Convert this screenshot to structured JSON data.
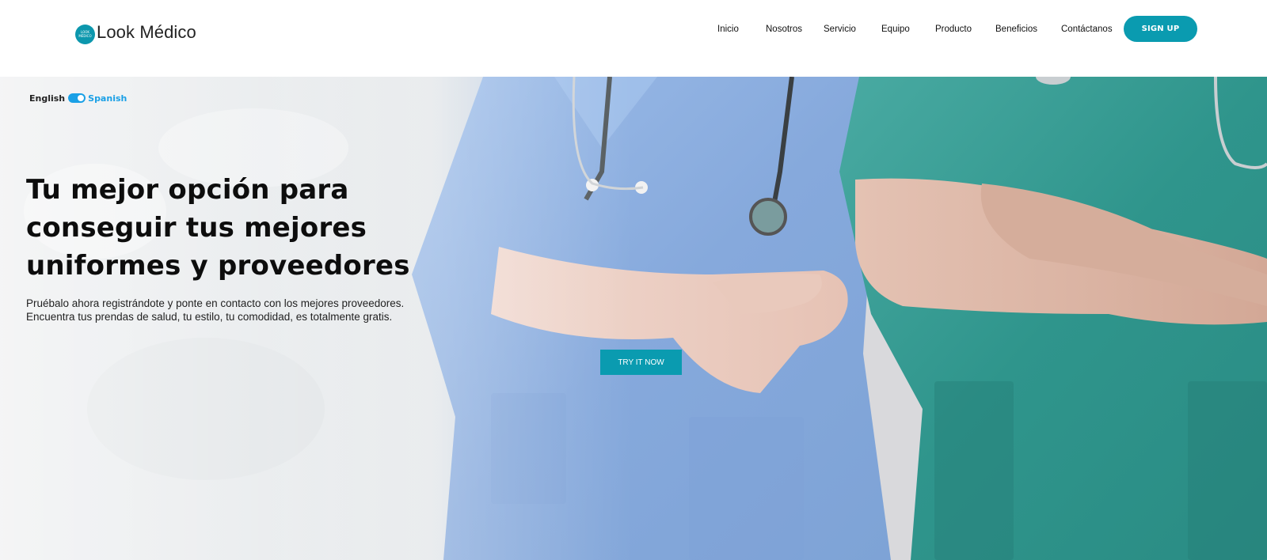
{
  "header": {
    "brand": {
      "logo_text_top": "LOOK",
      "logo_text_bottom": "MÉDICO",
      "name": "Look Médico"
    },
    "nav": [
      "Inicio",
      "Nosotros",
      "Servicio",
      "Equipo",
      "Producto",
      "Beneficios",
      "Contáctanos"
    ],
    "signup_label": "SIGN UP"
  },
  "hero": {
    "language": {
      "english_label": "English",
      "spanish_label": "Spanish"
    },
    "title": "Tu mejor opción para conseguir tus mejores uniformes y proveedores",
    "subtitle_line_1": "Pruébalo ahora registrándote y ponte en contacto con los mejores proveedores.",
    "subtitle_line_2": "Encuentra tus prendas de salud, tu estilo, tu comodidad, es totalmente gratis.",
    "cta_label": "TRY IT NOW"
  },
  "colors": {
    "accent": "#0a9bb0",
    "toggle": "#1aa0e6",
    "scrub_blue": "#8fb0e0",
    "scrub_green": "#37988e"
  },
  "icons": {
    "logo": "look-medico-logo-icon",
    "toggle": "language-toggle-switch"
  }
}
